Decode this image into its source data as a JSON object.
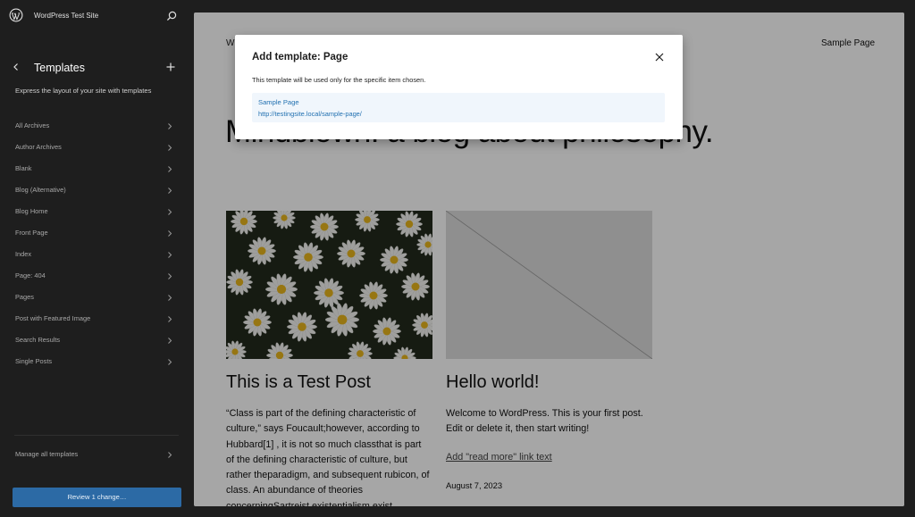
{
  "sidebar": {
    "site_title": "WordPress Test Site",
    "nav_title": "Templates",
    "description": "Express the layout of your site with templates",
    "templates": [
      "All Archives",
      "Author Archives",
      "Blank",
      "Blog (Alternative)",
      "Blog Home",
      "Front Page",
      "Index",
      "Page: 404",
      "Pages",
      "Post with Featured Image",
      "Search Results",
      "Single Posts"
    ],
    "manage_label": "Manage all templates",
    "review_label": "Review 1 change…"
  },
  "canvas": {
    "site_name_fragment": "W",
    "nav_link": "Sample Page",
    "hero_text": "Mindblown: a blog about philosophy.",
    "posts": [
      {
        "title": "This is a Test Post",
        "excerpt_lines": [
          "“Class is part of the defining characteristic of",
          "culture,” says Foucault;however, according to",
          "Hubbard[1] , it is not so much classthat is part",
          "of the defining characteristic of culture, but",
          "rather theparadigm, and subsequent rubicon, of",
          "class. An abundance of theories",
          "concerningSartreist existentialism exist"
        ]
      },
      {
        "title": "Hello world!",
        "excerpt_lines": [
          "Welcome to WordPress. This is your first post.",
          "Edit or delete it, then start writing!"
        ],
        "read_more": "Add \"read more\" link text",
        "date": "August 7, 2023"
      }
    ]
  },
  "modal": {
    "title": "Add template: Page",
    "description": "This template will be used only for the specific item chosen.",
    "suggestion": {
      "title": "Sample Page",
      "url": "http://testingsite.local/sample-page/"
    }
  },
  "colors": {
    "accent": "#2271b1",
    "review_button": "#2c6aa5",
    "sidebar_bg": "#1e1e1e"
  },
  "icons": [
    "wordpress-logo-icon",
    "search-icon",
    "chevron-left-icon",
    "plus-icon",
    "chevron-right-icon",
    "close-icon"
  ]
}
